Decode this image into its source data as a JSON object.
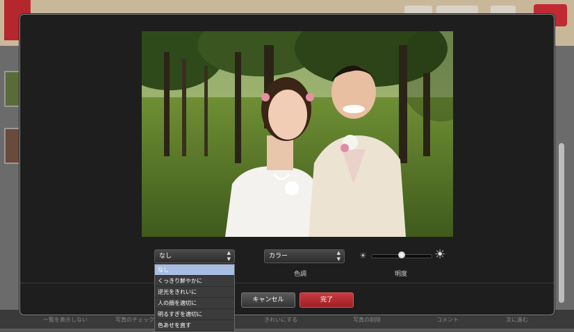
{
  "background": {
    "footer_items": [
      "一覧を表示しない",
      "写真のチェック",
      "",
      "きれいにする",
      "写真の削除",
      "コメント",
      "次に進む"
    ]
  },
  "editor": {
    "filter_select": {
      "value": "なし",
      "options": [
        "なし",
        "くっきり鮮やかに",
        "逆光をきれいに",
        "人の顔を適切に",
        "明るすぎを適切に",
        "色あせを直す"
      ],
      "selected_index": 0
    },
    "tone_select": {
      "value": "カラー"
    },
    "tone_label": "色調",
    "brightness_label": "明度",
    "brightness_value": 0.5,
    "cancel_label": "キャンセル",
    "done_label": "完了"
  }
}
